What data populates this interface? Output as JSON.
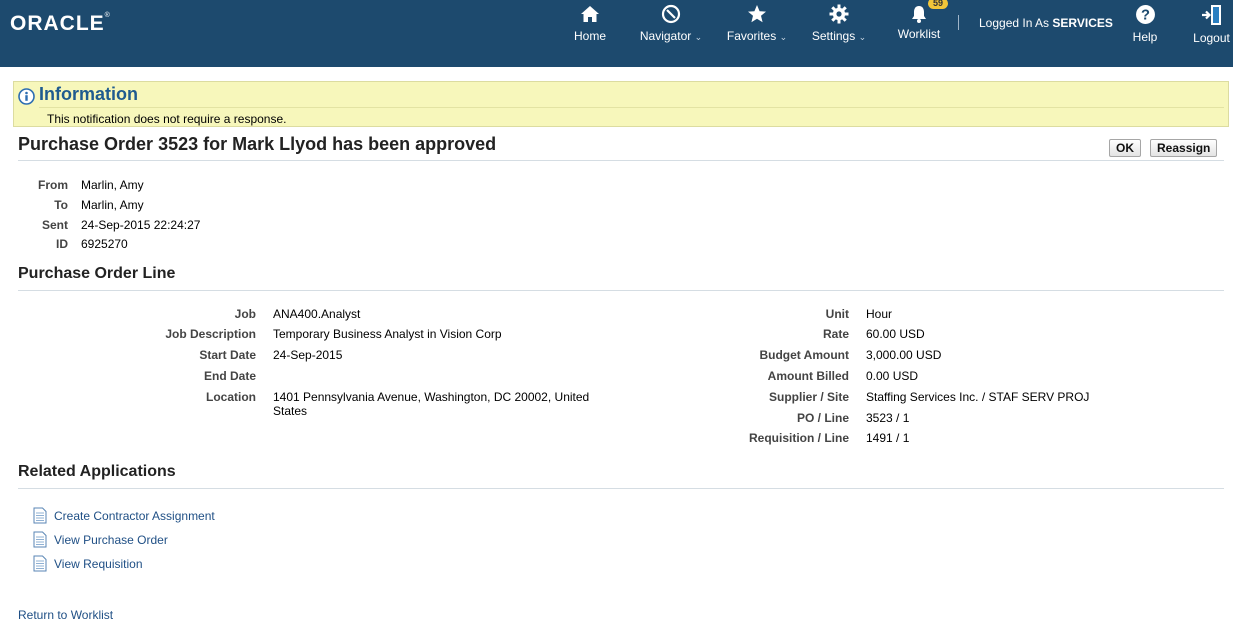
{
  "header": {
    "logo": "ORACLE",
    "nav": {
      "home": "Home",
      "navigator": "Navigator",
      "favorites": "Favorites",
      "settings": "Settings",
      "worklist": "Worklist",
      "worklist_count": "59",
      "help": "Help",
      "logout": "Logout"
    },
    "logged_in_prefix": "Logged In As",
    "logged_in_user": "SERVICES",
    "caret": "⌄"
  },
  "info": {
    "title": "Information",
    "message": "This notification does not require a response."
  },
  "page": {
    "title": "Purchase Order 3523 for Mark Llyod has been approved",
    "buttons": {
      "ok": "OK",
      "reassign": "Reassign"
    }
  },
  "notification": {
    "fields": [
      {
        "label": "From",
        "value": "Marlin, Amy"
      },
      {
        "label": "To",
        "value": "Marlin, Amy"
      },
      {
        "label": "Sent",
        "value": "24-Sep-2015 22:24:27"
      },
      {
        "label": "ID",
        "value": "6925270"
      }
    ]
  },
  "po_line": {
    "title": "Purchase Order Line",
    "left": [
      {
        "label": "Job",
        "value": "ANA400.Analyst"
      },
      {
        "label": "Job Description",
        "value": "Temporary Business Analyst in Vision Corp"
      },
      {
        "label": "Start Date",
        "value": "24-Sep-2015"
      },
      {
        "label": "End Date",
        "value": ""
      },
      {
        "label": "Location",
        "value": "1401 Pennsylvania Avenue, Washington, DC 20002, United States"
      }
    ],
    "right": [
      {
        "label": "Unit",
        "value": "Hour"
      },
      {
        "label": "Rate",
        "value": "60.00 USD"
      },
      {
        "label": "Budget Amount",
        "value": "3,000.00 USD"
      },
      {
        "label": "Amount Billed",
        "value": "0.00 USD"
      },
      {
        "label": "Supplier / Site",
        "value": "Staffing Services Inc. / STAF SERV PROJ"
      },
      {
        "label": "PO / Line",
        "value": "3523 / 1"
      },
      {
        "label": "Requisition / Line",
        "value": "1491 / 1"
      }
    ]
  },
  "related": {
    "title": "Related Applications",
    "links": [
      "Create Contractor Assignment",
      "View Purchase Order",
      "View Requisition"
    ]
  },
  "footer": {
    "return_link": "Return to Worklist"
  },
  "colors": {
    "header_bg": "#1d4a6e",
    "info_bg": "#f7f7bb",
    "link": "#1f4f85",
    "info_title": "#1f5b8f"
  }
}
